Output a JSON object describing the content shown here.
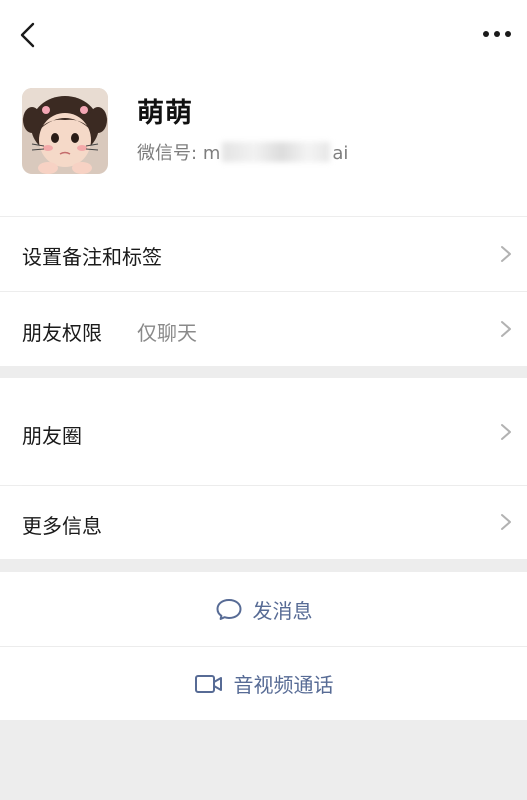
{
  "header": {
    "name": "萌萌",
    "wechat_id_label": "微信号:",
    "wechat_id_prefix": "m",
    "wechat_id_suffix": "ai",
    "icons": {
      "back": "chevron-left-icon",
      "more": "ellipsis-icon"
    }
  },
  "rows": {
    "remark": {
      "label": "设置备注和标签"
    },
    "permission": {
      "label": "朋友权限",
      "value": "仅聊天"
    },
    "moments": {
      "label": "朋友圈"
    },
    "more_info": {
      "label": "更多信息"
    }
  },
  "actions": {
    "message": {
      "label": "发消息",
      "icon": "chat-bubble-icon"
    },
    "call": {
      "label": "音视频通话",
      "icon": "video-camera-icon"
    }
  },
  "colors": {
    "accent": "#576b95",
    "background": "#ededed",
    "card": "#ffffff",
    "secondary_text": "#7d7d7d"
  }
}
